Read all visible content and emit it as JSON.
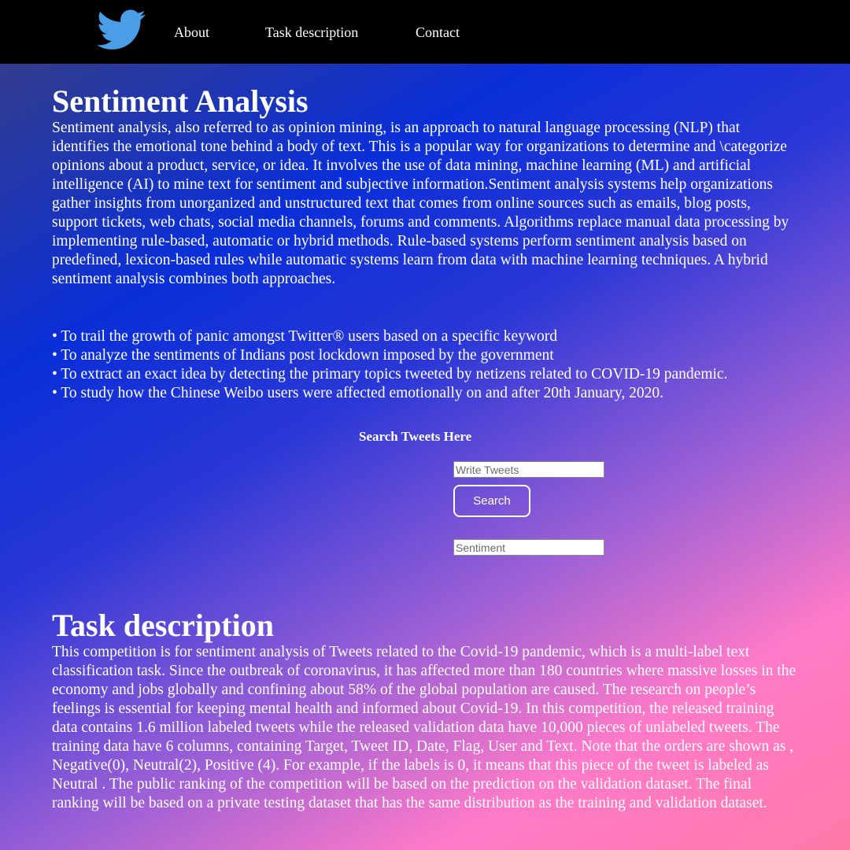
{
  "nav": {
    "logo_icon": "twitter-bird-icon",
    "links": [
      "About",
      "Task description",
      "Contact"
    ]
  },
  "intro": {
    "title": "Sentiment Analysis",
    "body": "Sentiment analysis, also referred to as opinion mining, is an approach to natural language processing (NLP) that identifies the emotional tone behind a body of text. This is a popular way for organizations to determine and \\categorize opinions about a product, service, or idea. It involves the use of data mining, machine learning (ML) and artificial intelligence (AI) to mine text for sentiment and subjective information.Sentiment analysis systems help organizations gather insights from unorganized and unstructured text that comes from online sources such as emails, blog posts, support tickets, web chats, social media channels, forums and comments. Algorithms replace manual data processing by implementing rule-based, automatic or hybrid methods. Rule-based systems perform sentiment analysis based on predefined, lexicon-based rules while automatic systems learn from data with machine learning techniques. A hybrid sentiment analysis combines both approaches."
  },
  "objectives": [
    "• To trail the growth of panic amongst Twitter® users based on a specific keyword",
    "• To analyze the sentiments of Indians post lockdown imposed by the government",
    "• To extract an exact idea by detecting the primary topics tweeted by netizens related to COVID-19 pandemic.",
    "• To study how the Chinese Weibo users were affected emotionally on and after 20th January, 2020."
  ],
  "search": {
    "label": "Search Tweets Here",
    "tweet_placeholder": "Write Tweets",
    "button_label": "Search",
    "sentiment_placeholder": "Sentiment"
  },
  "task": {
    "title": "Task description",
    "body": "This competition is for sentiment analysis of Tweets related to the Covid-19 pandemic, which is a multi-label text classification task. Since the outbreak of coronavirus, it has affected more than 180 countries where massive losses in the economy and jobs globally and confining about 58% of the global population are caused. The research on people’s feelings is essential for keeping mental health and informed about Covid-19. In this competition, the released training data contains 1.6 million labeled tweets while the released validation data have 10,000 pieces of unlabeled tweets. The training data have 6 columns, containing Target, Tweet ID, Date, Flag, User and Text. Note that the orders are shown as , Negative(0), Neutral(2), Positive (4). For example, if the labels is 0, it means that this piece of the tweet is labeled as Neutral . The public ranking of the competition will be based on the prediction on the validation dataset. The final ranking will be based on a private testing dataset that has the same distribution as the training and validation dataset."
  },
  "colors": {
    "navbar": "#000000",
    "logo": "#4a9ee8",
    "gradient_start": "#0a2fd8",
    "gradient_end": "#ff7ac8"
  }
}
